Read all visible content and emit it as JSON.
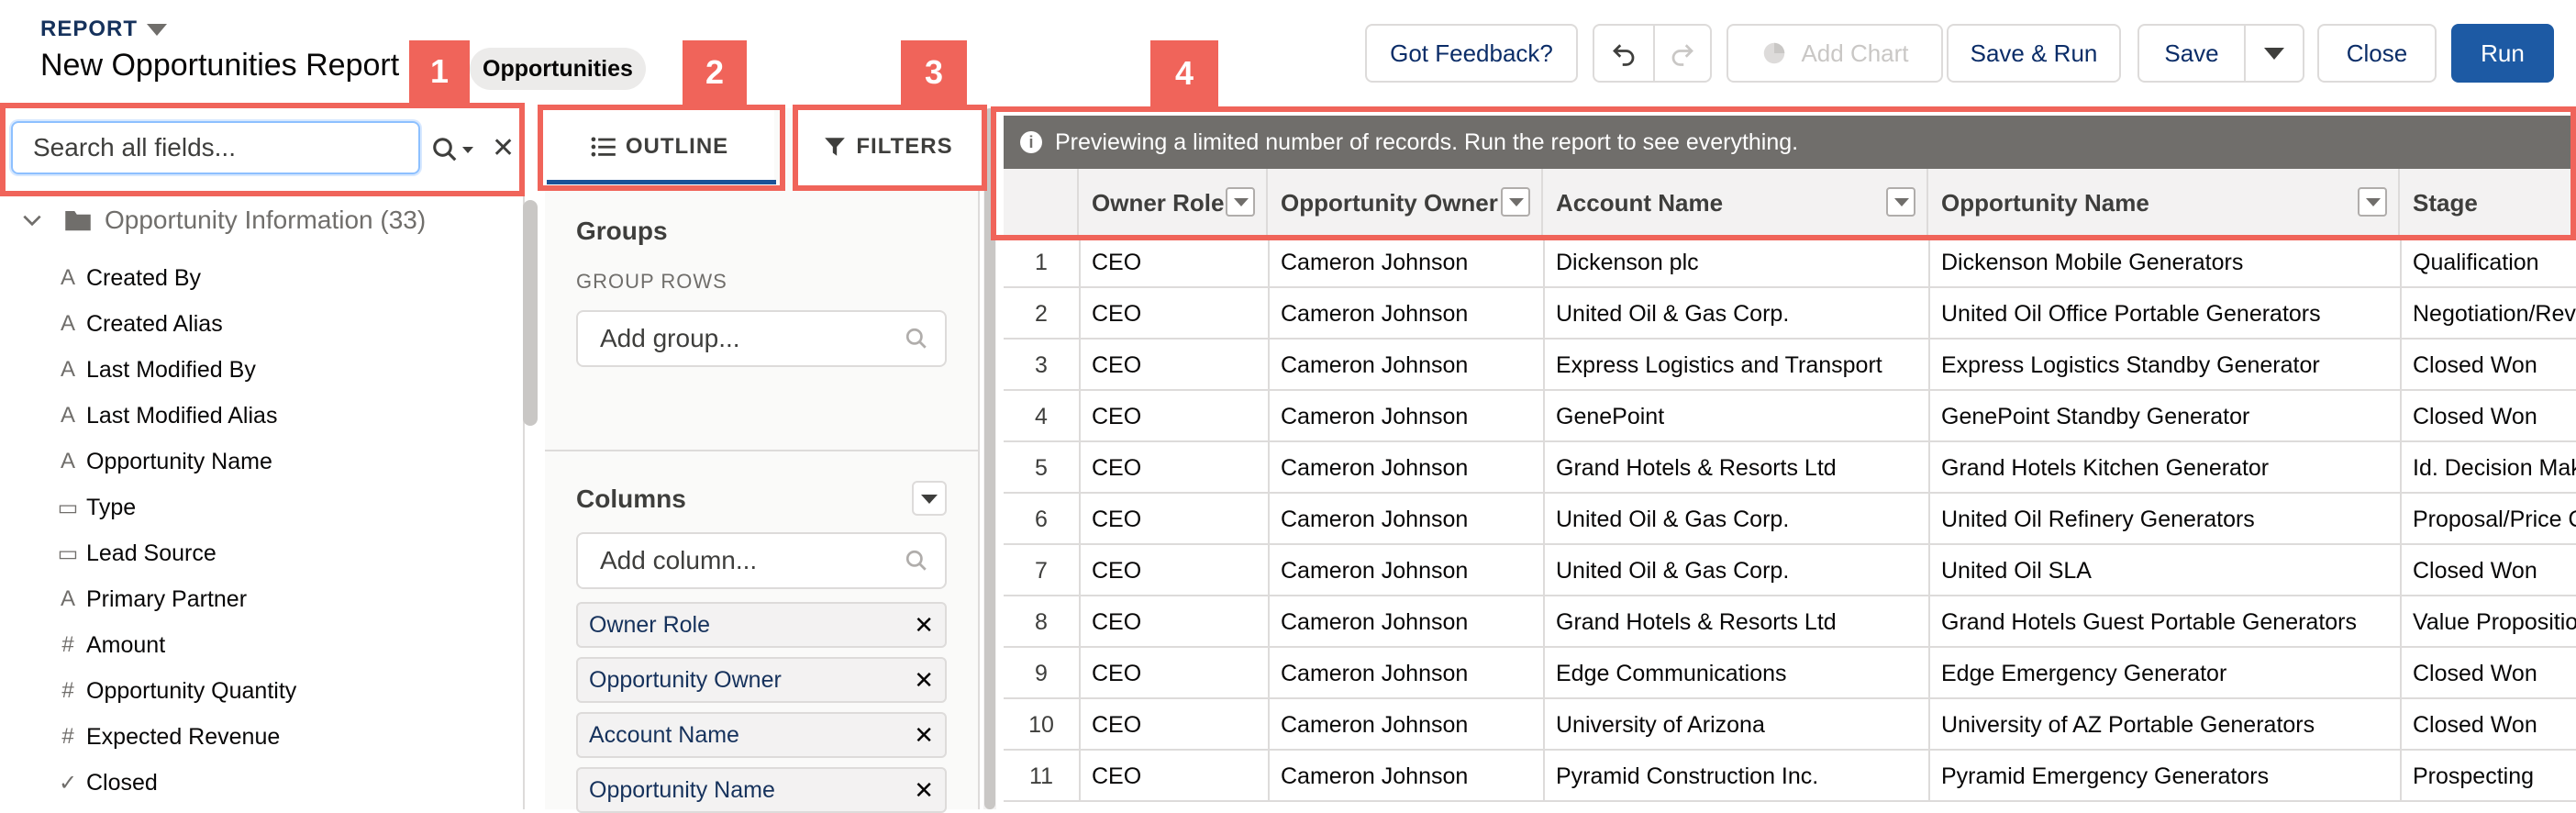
{
  "header": {
    "report_label": "REPORT",
    "title": "New Opportunities Report",
    "type_pill": "Opportunities",
    "badges": [
      "1",
      "2",
      "3",
      "4"
    ],
    "buttons": {
      "feedback": "Got Feedback?",
      "add_chart": "Add Chart",
      "save_run": "Save & Run",
      "save": "Save",
      "close": "Close",
      "run": "Run"
    }
  },
  "fields_panel": {
    "search_placeholder": "Search all fields...",
    "folder": "Opportunity Information (33)",
    "fields": [
      {
        "icon": "text",
        "label": "Created By"
      },
      {
        "icon": "text",
        "label": "Created Alias"
      },
      {
        "icon": "text",
        "label": "Last Modified By"
      },
      {
        "icon": "text",
        "label": "Last Modified Alias"
      },
      {
        "icon": "text",
        "label": "Opportunity Name"
      },
      {
        "icon": "picklist",
        "label": "Type"
      },
      {
        "icon": "picklist",
        "label": "Lead Source"
      },
      {
        "icon": "text",
        "label": "Primary Partner"
      },
      {
        "icon": "number",
        "label": "Amount"
      },
      {
        "icon": "number",
        "label": "Opportunity Quantity"
      },
      {
        "icon": "number",
        "label": "Expected Revenue"
      },
      {
        "icon": "checkbox",
        "label": "Closed"
      }
    ]
  },
  "outline": {
    "tab_outline": "OUTLINE",
    "tab_filters": "FILTERS",
    "groups_title": "Groups",
    "group_rows_label": "GROUP ROWS",
    "add_group_placeholder": "Add group...",
    "columns_title": "Columns",
    "add_column_placeholder": "Add column...",
    "columns": [
      "Owner Role",
      "Opportunity Owner",
      "Account Name",
      "Opportunity Name"
    ]
  },
  "preview": {
    "banner": "Previewing a limited number of records. Run the report to see everything.",
    "headers": [
      "Owner Role",
      "Opportunity Owner",
      "Account Name",
      "Opportunity Name",
      "Stage"
    ],
    "rows": [
      [
        "1",
        "CEO",
        "Cameron Johnson",
        "Dickenson plc",
        "Dickenson Mobile Generators",
        "Qualification"
      ],
      [
        "2",
        "CEO",
        "Cameron Johnson",
        "United Oil & Gas Corp.",
        "United Oil Office Portable Generators",
        "Negotiation/Review"
      ],
      [
        "3",
        "CEO",
        "Cameron Johnson",
        "Express Logistics and Transport",
        "Express Logistics Standby Generator",
        "Closed Won"
      ],
      [
        "4",
        "CEO",
        "Cameron Johnson",
        "GenePoint",
        "GenePoint Standby Generator",
        "Closed Won"
      ],
      [
        "5",
        "CEO",
        "Cameron Johnson",
        "Grand Hotels & Resorts Ltd",
        "Grand Hotels Kitchen Generator",
        "Id. Decision Makers"
      ],
      [
        "6",
        "CEO",
        "Cameron Johnson",
        "United Oil & Gas Corp.",
        "United Oil Refinery Generators",
        "Proposal/Price Quote"
      ],
      [
        "7",
        "CEO",
        "Cameron Johnson",
        "United Oil & Gas Corp.",
        "United Oil SLA",
        "Closed Won"
      ],
      [
        "8",
        "CEO",
        "Cameron Johnson",
        "Grand Hotels & Resorts Ltd",
        "Grand Hotels Guest Portable Generators",
        "Value Proposition"
      ],
      [
        "9",
        "CEO",
        "Cameron Johnson",
        "Edge Communications",
        "Edge Emergency Generator",
        "Closed Won"
      ],
      [
        "10",
        "CEO",
        "Cameron Johnson",
        "University of Arizona",
        "University of AZ Portable Generators",
        "Closed Won"
      ],
      [
        "11",
        "CEO",
        "Cameron Johnson",
        "Pyramid Construction Inc.",
        "Pyramid Emergency Generators",
        "Prospecting"
      ]
    ]
  },
  "colors": {
    "highlight": "#f0645a",
    "brand": "#1d5aa4",
    "banner": "#706e6b"
  }
}
